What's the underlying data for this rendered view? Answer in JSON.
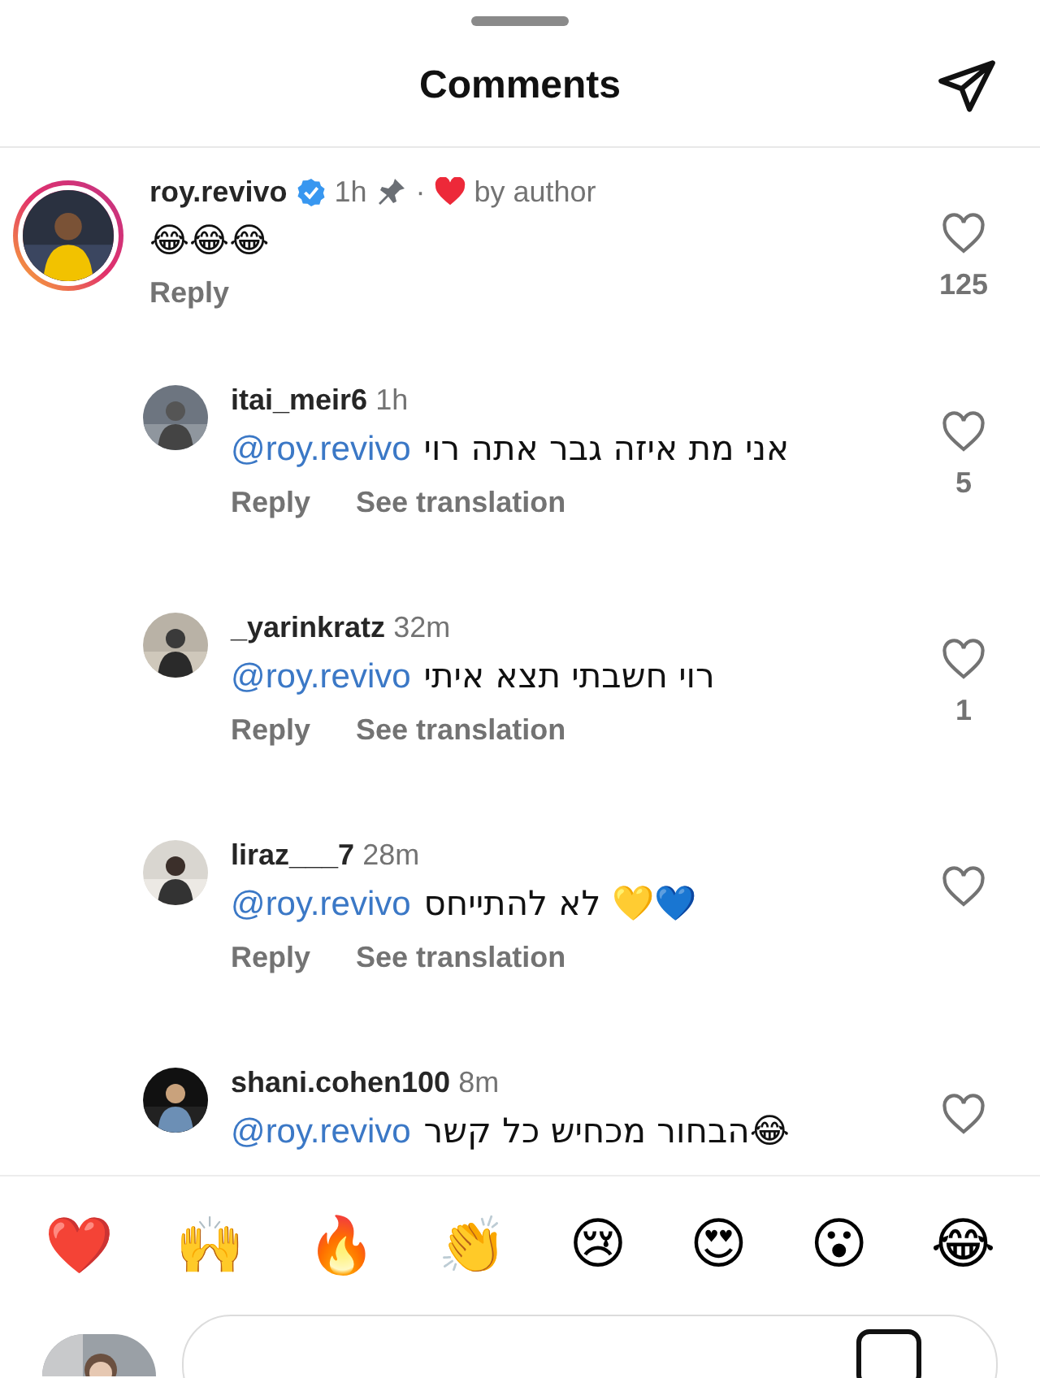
{
  "header": {
    "title": "Comments"
  },
  "comments": [
    {
      "username": "roy.revivo",
      "verified": true,
      "time": "1h",
      "pinned": true,
      "liked_by_author": true,
      "liked_by_author_label": "by author",
      "separator": "·",
      "story_ring": true,
      "reply_level": false,
      "text": "😂😂😂",
      "actions": [
        "Reply"
      ],
      "likes": "125"
    },
    {
      "username": "itai_meir6",
      "verified": false,
      "time": "1h",
      "pinned": false,
      "liked_by_author": false,
      "story_ring": false,
      "reply_level": true,
      "mention": "@roy.revivo",
      "text": "אני מת איזה גבר אתה רוי",
      "actions": [
        "Reply",
        "See translation"
      ],
      "likes": "5"
    },
    {
      "username": "_yarinkratz",
      "verified": false,
      "time": "32m",
      "pinned": false,
      "liked_by_author": false,
      "story_ring": false,
      "reply_level": true,
      "mention": "@roy.revivo",
      "text": "רוי חשבתי תצא איתי",
      "actions": [
        "Reply",
        "See translation"
      ],
      "likes": "1"
    },
    {
      "username": "liraz___7",
      "verified": false,
      "time": "28m",
      "pinned": false,
      "liked_by_author": false,
      "story_ring": false,
      "reply_level": true,
      "mention": "@roy.revivo",
      "text": "לא להתייחס 💛💙",
      "actions": [
        "Reply",
        "See translation"
      ]
    },
    {
      "username": "shani.cohen100",
      "verified": false,
      "time": "8m",
      "pinned": false,
      "liked_by_author": false,
      "story_ring": false,
      "reply_level": true,
      "mention": "@roy.revivo",
      "text": "הבחור מכחיש כל קשר😂"
    }
  ],
  "reactions": [
    "❤️",
    "🙌",
    "🔥",
    "👏",
    "😢",
    "😍",
    "😮",
    "😂"
  ]
}
